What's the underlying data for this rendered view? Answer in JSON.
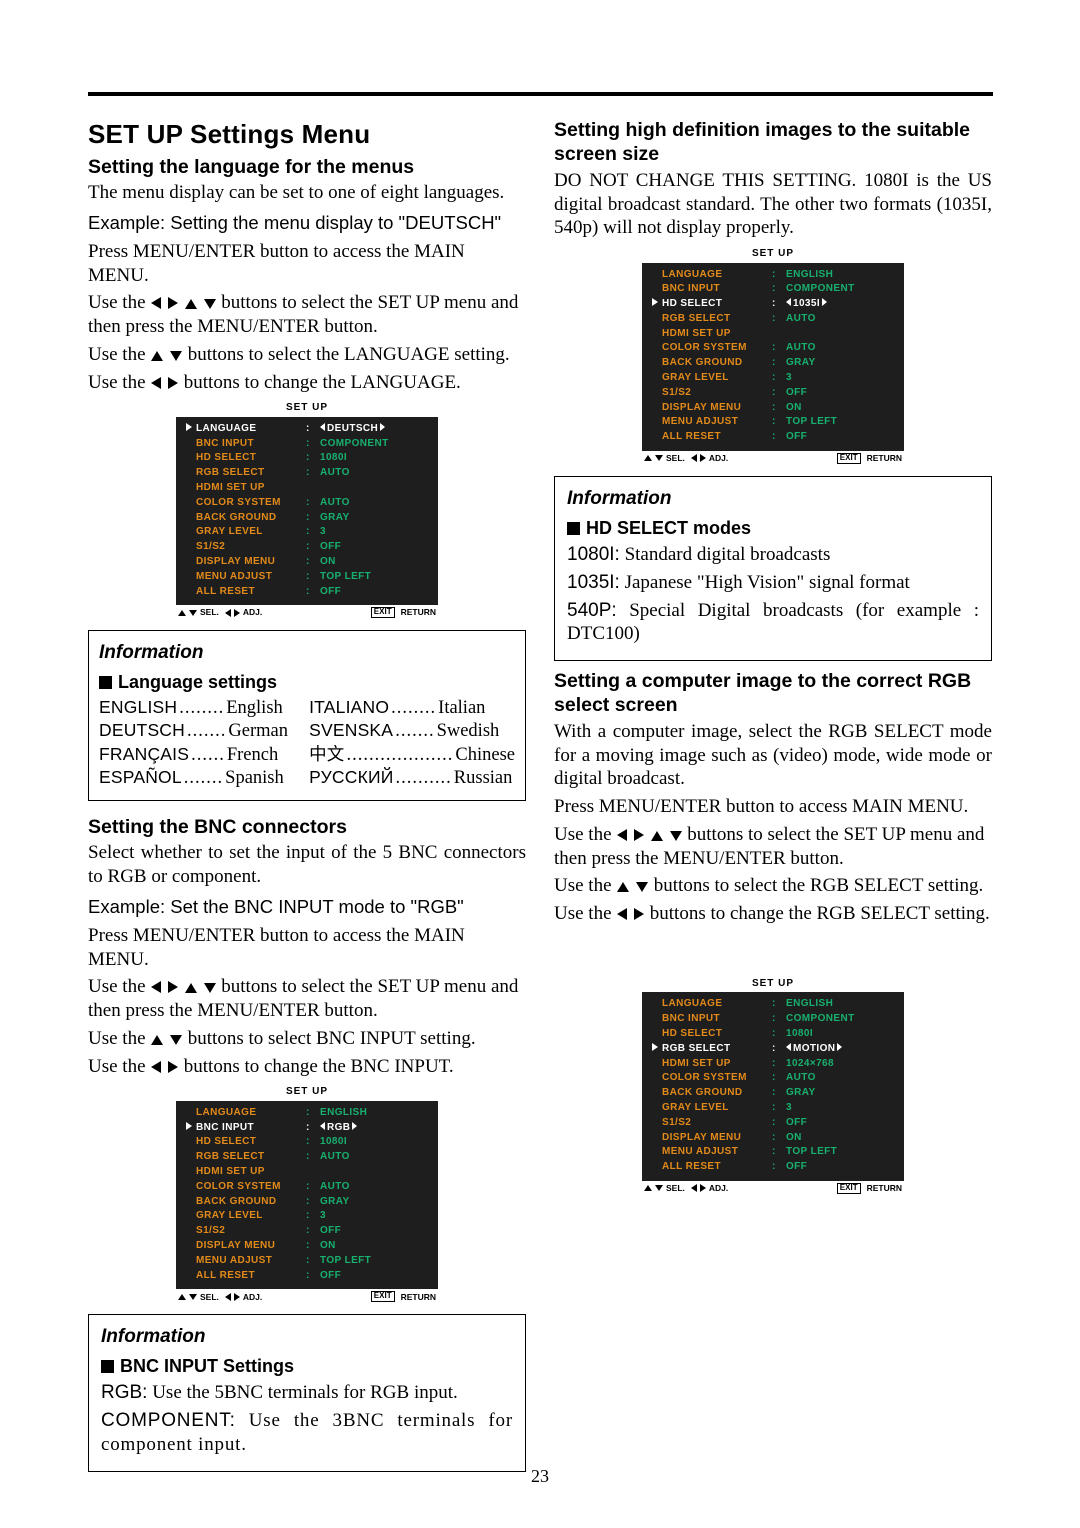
{
  "pageTitle": "SET UP Settings Menu",
  "pageNumber": "23",
  "osd": {
    "title": "SET UP",
    "footer": {
      "sel": "SEL.",
      "adj": "ADJ.",
      "exit": "EXIT",
      "return": "RETURN"
    },
    "menus": {
      "lang": {
        "selected": 0,
        "rows": [
          {
            "label": "LANGUAGE",
            "value": "DEUTSCH",
            "lr": true
          },
          {
            "label": "BNC INPUT",
            "value": "COMPONENT"
          },
          {
            "label": "HD SELECT",
            "value": "1080I"
          },
          {
            "label": "RGB SELECT",
            "value": "AUTO"
          },
          {
            "label": "HDMI SET UP",
            "value": ""
          },
          {
            "label": "COLOR SYSTEM",
            "value": "AUTO"
          },
          {
            "label": "BACK GROUND",
            "value": "GRAY"
          },
          {
            "label": "GRAY LEVEL",
            "value": "3"
          },
          {
            "label": "S1/S2",
            "value": "OFF"
          },
          {
            "label": "DISPLAY MENU",
            "value": "ON"
          },
          {
            "label": "MENU ADJUST",
            "value": "TOP LEFT"
          },
          {
            "label": "ALL RESET",
            "value": "OFF"
          }
        ]
      },
      "bnc": {
        "selected": 1,
        "rows": [
          {
            "label": "LANGUAGE",
            "value": "ENGLISH"
          },
          {
            "label": "BNC INPUT",
            "value": "RGB",
            "lr": true
          },
          {
            "label": "HD SELECT",
            "value": "1080I"
          },
          {
            "label": "RGB SELECT",
            "value": "AUTO"
          },
          {
            "label": "HDMI SET UP",
            "value": ""
          },
          {
            "label": "COLOR SYSTEM",
            "value": "AUTO"
          },
          {
            "label": "BACK GROUND",
            "value": "GRAY"
          },
          {
            "label": "GRAY LEVEL",
            "value": "3"
          },
          {
            "label": "S1/S2",
            "value": "OFF"
          },
          {
            "label": "DISPLAY MENU",
            "value": "ON"
          },
          {
            "label": "MENU ADJUST",
            "value": "TOP LEFT"
          },
          {
            "label": "ALL RESET",
            "value": "OFF"
          }
        ]
      },
      "hd": {
        "selected": 2,
        "rows": [
          {
            "label": "LANGUAGE",
            "value": "ENGLISH"
          },
          {
            "label": "BNC INPUT",
            "value": "COMPONENT"
          },
          {
            "label": "HD SELECT",
            "value": "1035I",
            "lr": true
          },
          {
            "label": "RGB SELECT",
            "value": "AUTO"
          },
          {
            "label": "HDMI SET UP",
            "value": ""
          },
          {
            "label": "COLOR SYSTEM",
            "value": "AUTO"
          },
          {
            "label": "BACK GROUND",
            "value": "GRAY"
          },
          {
            "label": "GRAY LEVEL",
            "value": "3"
          },
          {
            "label": "S1/S2",
            "value": "OFF"
          },
          {
            "label": "DISPLAY MENU",
            "value": "ON"
          },
          {
            "label": "MENU ADJUST",
            "value": "TOP LEFT"
          },
          {
            "label": "ALL RESET",
            "value": "OFF"
          }
        ]
      },
      "rgb": {
        "selected": 3,
        "rows": [
          {
            "label": "LANGUAGE",
            "value": "ENGLISH"
          },
          {
            "label": "BNC INPUT",
            "value": "COMPONENT"
          },
          {
            "label": "HD SELECT",
            "value": "1080I"
          },
          {
            "label": "RGB SELECT",
            "value": "MOTION",
            "lr": true
          },
          {
            "label": "HDMI SET UP",
            "value": "1024×768"
          },
          {
            "label": "COLOR SYSTEM",
            "value": "AUTO"
          },
          {
            "label": "BACK GROUND",
            "value": "GRAY"
          },
          {
            "label": "GRAY LEVEL",
            "value": "3"
          },
          {
            "label": "S1/S2",
            "value": "OFF"
          },
          {
            "label": "DISPLAY MENU",
            "value": "ON"
          },
          {
            "label": "MENU ADJUST",
            "value": "TOP LEFT"
          },
          {
            "label": "ALL RESET",
            "value": "OFF"
          }
        ]
      }
    }
  },
  "left": {
    "lang": {
      "h": "Setting the language for the menus",
      "p1": "The menu display can be set to one of eight languages.",
      "ex": "Example: Setting the menu display to \"DEUTSCH\"",
      "s1": "Press MENU/ENTER button to access the MAIN MENU.",
      "s2a": "Use the ",
      "s2b": " buttons to select the SET UP menu and then press the MENU/ENTER button.",
      "s3a": "Use the ",
      "s3b": " buttons to select the LANGUAGE setting.",
      "s4a": "Use the ",
      "s4b": " buttons to change the LANGUAGE."
    },
    "langBox": {
      "h": "Information",
      "sub": "Language settings",
      "rows": [
        [
          "ENGLISH",
          "........",
          "English",
          "ITALIANO",
          "........",
          "Italian"
        ],
        [
          "DEUTSCH",
          ".......",
          "German",
          "SVENSKA",
          ".......",
          "Swedish"
        ],
        [
          "FRANÇAIS",
          "......",
          "French",
          "中文",
          "...................",
          "Chinese"
        ],
        [
          "ESPAÑOL",
          ".......",
          "Spanish",
          "РУССКИЙ",
          "..........",
          "Russian"
        ]
      ]
    },
    "bnc": {
      "h": "Setting the BNC connectors",
      "p1": "Select whether to set the input of the 5 BNC connectors to RGB or component.",
      "ex": "Example: Set the BNC INPUT mode to \"RGB\"",
      "s1": "Press MENU/ENTER button to access the MAIN MENU.",
      "s2a": "Use the ",
      "s2b": " buttons to select the SET UP menu and then press the MENU/ENTER button.",
      "s3a": "Use the ",
      "s3b": " buttons to select BNC INPUT setting.",
      "s4a": "Use the ",
      "s4b": " buttons to change the BNC INPUT."
    },
    "bncBox": {
      "h": "Information",
      "sub": "BNC INPUT Settings",
      "l1a": "RGB:",
      "l1b": " Use the 5BNC terminals for RGB input.",
      "l2a": "COMPONENT:",
      "l2b": " Use the 3BNC terminals for component input."
    }
  },
  "right": {
    "hd": {
      "h": "Setting high definition images to the suitable screen size",
      "p1": "DO NOT CHANGE THIS SETTING. 1080I is the US digital broadcast standard. The other two formats (1035I, 540p) will not display properly."
    },
    "hdBox": {
      "h": "Information",
      "sub": "HD SELECT modes",
      "l1a": "1080I:",
      "l1b": " Standard digital broadcasts",
      "l2a": "1035I:",
      "l2b": " Japanese \"High Vision\" signal format",
      "l3a": "540P:",
      "l3b": " Special Digital broadcasts (for example : DTC100)"
    },
    "rgb": {
      "h": "Setting a computer image to the correct RGB select screen",
      "p1": "With a computer image, select the RGB SELECT mode for a moving image such as (video) mode, wide mode or digital broadcast.",
      "s1": "Press MENU/ENTER button to access MAIN MENU.",
      "s2a": "Use the ",
      "s2b": " buttons to select the SET UP menu and then press the MENU/ENTER button.",
      "s3a": "Use the ",
      "s3b": " buttons to select the RGB SELECT setting.",
      "s4a": "Use the ",
      "s4b": " buttons to change the RGB SELECT setting."
    }
  }
}
